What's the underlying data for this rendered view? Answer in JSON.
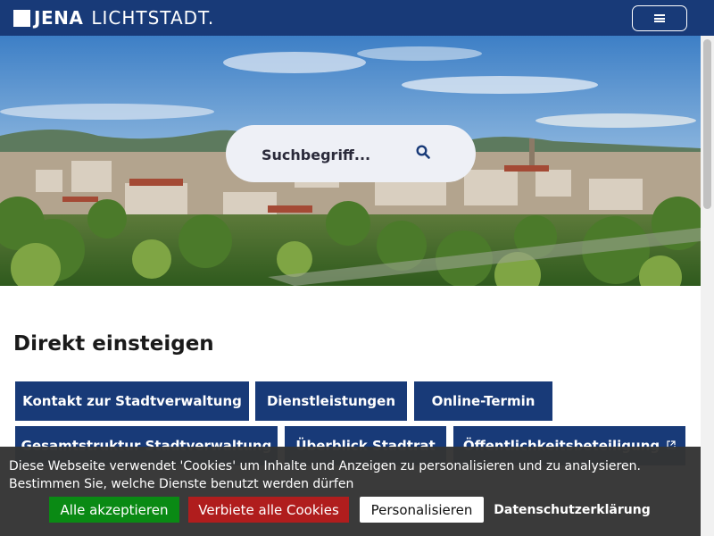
{
  "header": {
    "logo_bold": "JENA",
    "logo_light": "LICHTSTADT."
  },
  "hero": {
    "search_placeholder": "Suchbegriff..."
  },
  "main": {
    "title": "Direkt einsteigen",
    "quicklinks": [
      "Kontakt zur Stadtverwaltung",
      "Dienstleistungen",
      "Online-Termin",
      "Gesamtstruktur Stadtverwaltung",
      "Überblick Stadtrat",
      "Öffentlichkeitsbeteiligung"
    ]
  },
  "cookie": {
    "text": "Diese Webseite verwendet 'Cookies' um Inhalte und Anzeigen zu personalisieren und zu analysieren. Bestimmen Sie, welche Dienste benutzt werden dürfen",
    "accept_all": "Alle akzeptieren",
    "deny_all": "Verbiete alle Cookies",
    "personalize": "Personalisieren",
    "privacy": "Datenschutzerklärung"
  },
  "colors": {
    "brand": "#183a78",
    "accept": "#0a8a14",
    "deny": "#b01d1d",
    "banner": "#343434"
  },
  "icons": {
    "menu": "hamburger-icon",
    "search": "search-icon",
    "external": "external-link-icon"
  }
}
